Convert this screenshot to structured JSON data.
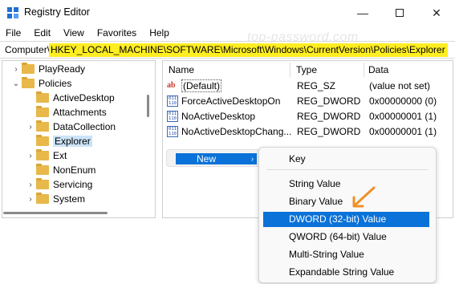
{
  "window": {
    "title": "Registry Editor",
    "controls": {
      "minimize": "—",
      "close": "✕"
    }
  },
  "menu": [
    "File",
    "Edit",
    "View",
    "Favorites",
    "Help"
  ],
  "address": {
    "prefix": "Computer\\",
    "path": "HKEY_LOCAL_MACHINE\\SOFTWARE\\Microsoft\\Windows\\CurrentVersion\\Policies\\Explorer"
  },
  "watermark": "top-password.com",
  "tree": [
    {
      "label": "PlayReady",
      "expander": "›",
      "selected": false
    },
    {
      "label": "Policies",
      "expander": "⌄",
      "selected": false
    },
    {
      "label": "ActiveDesktop",
      "expander": "",
      "selected": false
    },
    {
      "label": "Attachments",
      "expander": "",
      "selected": false
    },
    {
      "label": "DataCollection",
      "expander": "›",
      "selected": false
    },
    {
      "label": "Explorer",
      "expander": "",
      "selected": true
    },
    {
      "label": "Ext",
      "expander": "›",
      "selected": false
    },
    {
      "label": "NonEnum",
      "expander": "",
      "selected": false
    },
    {
      "label": "Servicing",
      "expander": "›",
      "selected": false
    },
    {
      "label": "System",
      "expander": "›",
      "selected": false
    }
  ],
  "values": {
    "headers": {
      "name": "Name",
      "type": "Type",
      "data": "Data"
    },
    "rows": [
      {
        "icon": "ab",
        "name": "(Default)",
        "type": "REG_SZ",
        "data": "(value not set)"
      },
      {
        "icon": "binary",
        "name": "ForceActiveDesktopOn",
        "type": "REG_DWORD",
        "data": "0x00000000 (0)"
      },
      {
        "icon": "binary",
        "name": "NoActiveDesktop",
        "type": "REG_DWORD",
        "data": "0x00000001 (1)"
      },
      {
        "icon": "binary",
        "name": "NoActiveDesktopChang...",
        "type": "REG_DWORD",
        "data": "0x00000001 (1)"
      }
    ]
  },
  "context_menu": {
    "new_label": "New",
    "new_arrow": "›"
  },
  "submenu": {
    "items": [
      {
        "label": "Key",
        "highlighted": false
      },
      {
        "label": "String Value",
        "highlighted": false
      },
      {
        "label": "Binary Value",
        "highlighted": false
      },
      {
        "label": "DWORD (32-bit) Value",
        "highlighted": true
      },
      {
        "label": "QWORD (64-bit) Value",
        "highlighted": false
      },
      {
        "label": "Multi-String Value",
        "highlighted": false
      },
      {
        "label": "Expandable String Value",
        "highlighted": false
      }
    ]
  },
  "colors": {
    "highlight_blue": "#0a72d8",
    "address_highlight": "#ffee22",
    "folder": "#e8b84a",
    "arrow": "#f0902a"
  }
}
